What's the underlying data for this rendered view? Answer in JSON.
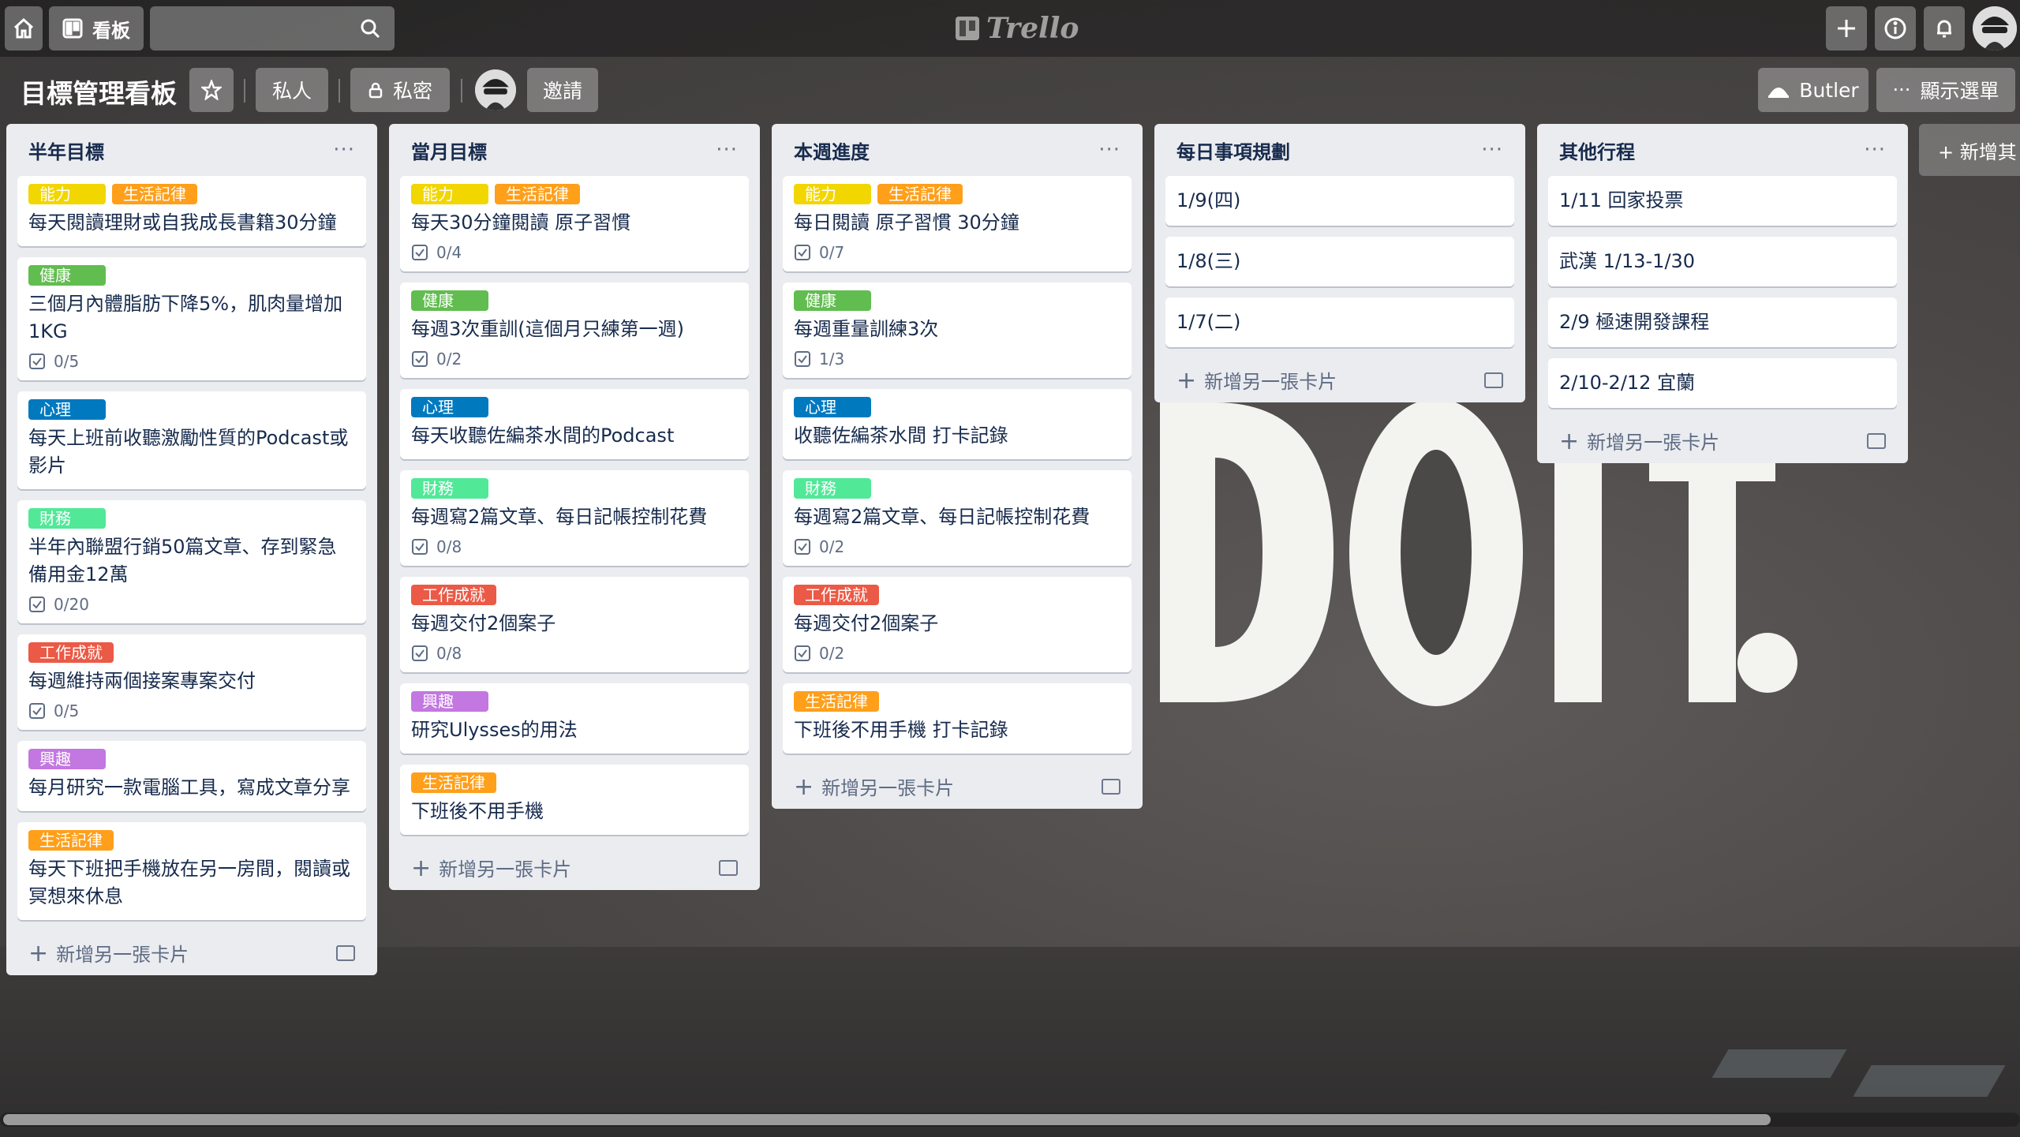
{
  "colors": {
    "ability": "#f2d600",
    "lifestyle": "#ff9f1a",
    "health": "#61bd4f",
    "mind": "#0079bf",
    "finance": "#51e898",
    "work": "#eb5a46",
    "hobby": "#c377e0"
  },
  "topbar": {
    "board_button": "看板",
    "logo": "Trello"
  },
  "board": {
    "title": "目標管理看板",
    "visibility": "私人",
    "privacy": "私密",
    "invite": "邀請",
    "butler": "Butler",
    "menu": "顯示選單",
    "add_list": "+ 新增其"
  },
  "add_card_label": "新增另一張卡片",
  "lists": [
    {
      "title": "半年目標",
      "cards": [
        {
          "labels": [
            {
              "text": "能力",
              "color": "ability"
            },
            {
              "text": "生活記律",
              "color": "lifestyle"
            }
          ],
          "title": "每天閱讀理財或自我成長書籍30分鐘",
          "badge": ""
        },
        {
          "labels": [
            {
              "text": "健康",
              "color": "health"
            }
          ],
          "title": "三個月內體脂肪下降5%，肌肉量增加1KG",
          "badge": "0/5"
        },
        {
          "labels": [
            {
              "text": "心理",
              "color": "mind"
            }
          ],
          "title": "每天上班前收聽激勵性質的Podcast或影片",
          "badge": ""
        },
        {
          "labels": [
            {
              "text": "財務",
              "color": "finance"
            }
          ],
          "title": "半年內聯盟行銷50篇文章、存到緊急備用金12萬",
          "badge": "0/20"
        },
        {
          "labels": [
            {
              "text": "工作成就",
              "color": "work"
            }
          ],
          "title": "每週維持兩個接案專案交付",
          "badge": "0/5"
        },
        {
          "labels": [
            {
              "text": "興趣",
              "color": "hobby"
            }
          ],
          "title": "每月研究一款電腦工具，寫成文章分享",
          "badge": ""
        },
        {
          "labels": [
            {
              "text": "生活記律",
              "color": "lifestyle"
            }
          ],
          "title": "每天下班把手機放在另一房間，閱讀或冥想來休息",
          "badge": ""
        }
      ]
    },
    {
      "title": "當月目標",
      "cards": [
        {
          "labels": [
            {
              "text": "能力",
              "color": "ability"
            },
            {
              "text": "生活記律",
              "color": "lifestyle"
            }
          ],
          "title": "每天30分鐘閱讀 原子習慣",
          "badge": "0/4"
        },
        {
          "labels": [
            {
              "text": "健康",
              "color": "health"
            }
          ],
          "title": "每週3次重訓(這個月只練第一週)",
          "badge": "0/2"
        },
        {
          "labels": [
            {
              "text": "心理",
              "color": "mind"
            }
          ],
          "title": "每天收聽佐編茶水間的Podcast",
          "badge": ""
        },
        {
          "labels": [
            {
              "text": "財務",
              "color": "finance"
            }
          ],
          "title": "每週寫2篇文章、每日記帳控制花費",
          "badge": "0/8"
        },
        {
          "labels": [
            {
              "text": "工作成就",
              "color": "work"
            }
          ],
          "title": "每週交付2個案子",
          "badge": "0/8"
        },
        {
          "labels": [
            {
              "text": "興趣",
              "color": "hobby"
            }
          ],
          "title": "研究Ulysses的用法",
          "badge": ""
        },
        {
          "labels": [
            {
              "text": "生活記律",
              "color": "lifestyle"
            }
          ],
          "title": "下班後不用手機",
          "badge": ""
        }
      ]
    },
    {
      "title": "本週進度",
      "cards": [
        {
          "labels": [
            {
              "text": "能力",
              "color": "ability"
            },
            {
              "text": "生活記律",
              "color": "lifestyle"
            }
          ],
          "title": "每日閱讀 原子習慣 30分鐘",
          "badge": "0/7"
        },
        {
          "labels": [
            {
              "text": "健康",
              "color": "health"
            }
          ],
          "title": "每週重量訓練3次",
          "badge": "1/3"
        },
        {
          "labels": [
            {
              "text": "心理",
              "color": "mind"
            }
          ],
          "title": "收聽佐編茶水間 打卡記錄",
          "badge": ""
        },
        {
          "labels": [
            {
              "text": "財務",
              "color": "finance"
            }
          ],
          "title": "每週寫2篇文章、每日記帳控制花費",
          "badge": "0/2"
        },
        {
          "labels": [
            {
              "text": "工作成就",
              "color": "work"
            }
          ],
          "title": "每週交付2個案子",
          "badge": "0/2"
        },
        {
          "labels": [
            {
              "text": "生活記律",
              "color": "lifestyle"
            }
          ],
          "title": "下班後不用手機 打卡記錄",
          "badge": ""
        }
      ]
    },
    {
      "title": "每日事項規劃",
      "cards": [
        {
          "labels": [],
          "title": "1/9(四)",
          "badge": ""
        },
        {
          "labels": [],
          "title": "1/8(三)",
          "badge": ""
        },
        {
          "labels": [],
          "title": "1/7(二)",
          "badge": ""
        }
      ]
    },
    {
      "title": "其他行程",
      "cards": [
        {
          "labels": [],
          "title": "1/11 回家投票",
          "badge": ""
        },
        {
          "labels": [],
          "title": "武漢 1/13-1/30",
          "badge": ""
        },
        {
          "labels": [],
          "title": "2/9 極速開發課程",
          "badge": ""
        },
        {
          "labels": [],
          "title": "2/10-2/12 宜蘭",
          "badge": ""
        }
      ]
    }
  ]
}
